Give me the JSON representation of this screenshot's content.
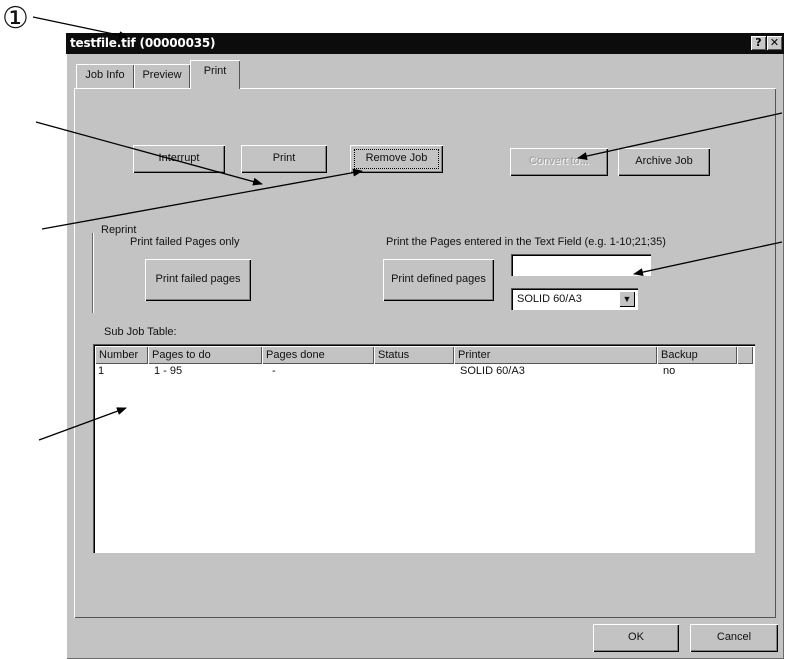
{
  "callout": {
    "number": "①"
  },
  "window": {
    "title": "testfile.tif (00000035)",
    "help_btn": "?",
    "close_btn": "✕"
  },
  "tabs": [
    {
      "label": "Job Info"
    },
    {
      "label": "Preview"
    },
    {
      "label": "Print"
    }
  ],
  "actions": {
    "interrupt": "Interrupt",
    "print": "Print",
    "remove_job": "Remove Job",
    "convert_to": "Convert to...",
    "archive_job": "Archive Job"
  },
  "reprint": {
    "group_label": "Reprint",
    "failed_only_label": "Print failed Pages only",
    "print_failed_btn": "Print failed pages",
    "entered_label": "Print the Pages entered in the Text Field (e.g. 1-10;21;35)",
    "print_defined_btn": "Print defined pages",
    "pages_input_value": "",
    "printer_selected": "SOLID 60/A3"
  },
  "sub_job_table": {
    "label": "Sub Job Table:",
    "columns": [
      "Number",
      "Pages to do",
      "Pages done",
      "Status",
      "Printer",
      "Backup"
    ],
    "rows": [
      [
        "1",
        "1 - 95",
        "-",
        "",
        "SOLID 60/A3",
        "no"
      ]
    ]
  },
  "footer": {
    "ok": "OK",
    "cancel": "Cancel"
  }
}
